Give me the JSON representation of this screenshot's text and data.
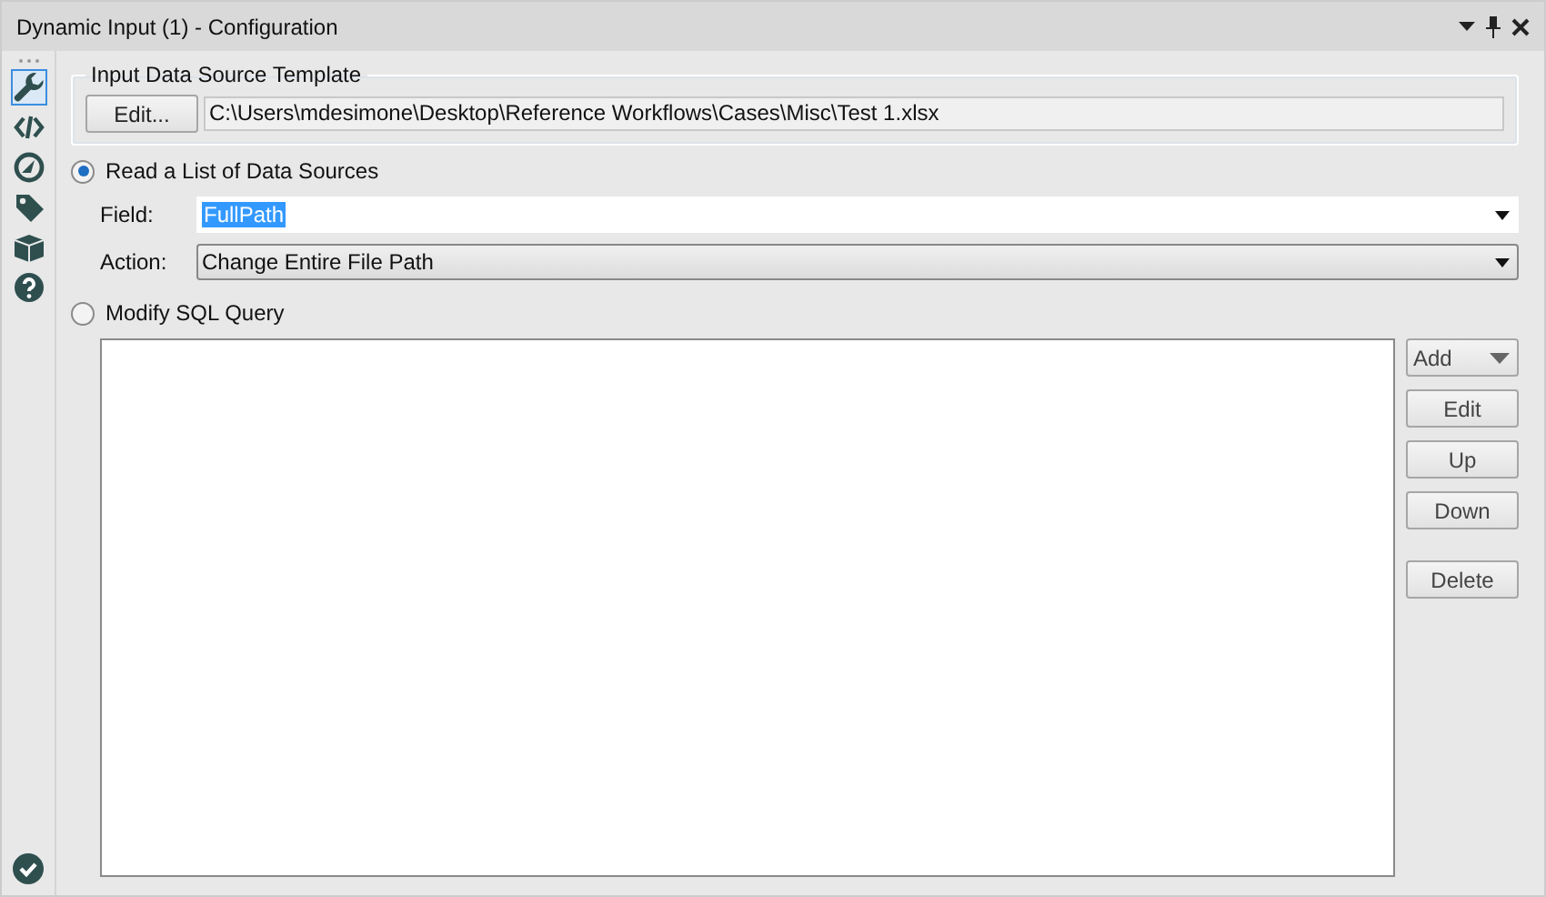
{
  "window": {
    "title": "Dynamic Input (1) - Configuration"
  },
  "sidebar": {
    "items": [
      {
        "kind": "wrench",
        "selected": true
      },
      {
        "kind": "code",
        "selected": false
      },
      {
        "kind": "compass",
        "selected": false
      },
      {
        "kind": "tag",
        "selected": false
      },
      {
        "kind": "box",
        "selected": false
      },
      {
        "kind": "help",
        "selected": false
      }
    ]
  },
  "template": {
    "title": "Input Data Source Template",
    "button": "Edit...",
    "path": "C:\\Users\\mdesimone\\Desktop\\Reference Workflows\\Cases\\Misc\\Test 1.xlsx"
  },
  "options": [
    {
      "label": "Read a List of Data Sources",
      "selected": true
    },
    {
      "label": "Modify SQL Query",
      "selected": false
    }
  ],
  "field": {
    "label": "Field:",
    "value": "FullPath"
  },
  "action": {
    "label": "Action:",
    "value": "Change Entire File Path"
  },
  "sql_buttons": [
    {
      "label": "Add",
      "kind": "dropdown"
    },
    {
      "label": "Edit",
      "kind": "button"
    },
    {
      "label": "Up",
      "kind": "button"
    },
    {
      "label": "Down",
      "kind": "button"
    },
    {
      "label": "Delete",
      "kind": "button",
      "gap": true
    }
  ]
}
